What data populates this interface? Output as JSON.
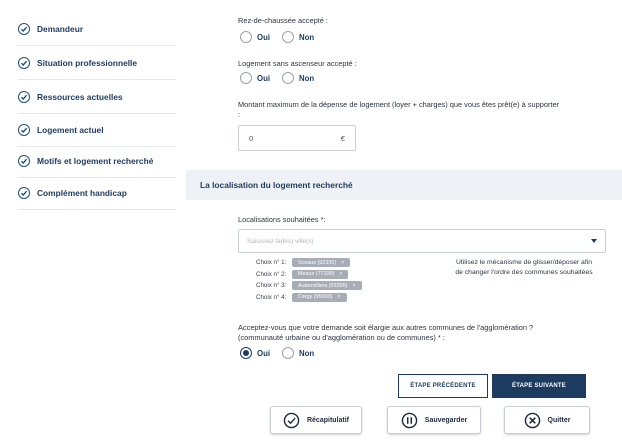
{
  "sidebar": {
    "items": [
      {
        "label": "Demandeur"
      },
      {
        "label": "Situation professionnelle"
      },
      {
        "label": "Ressources actuelles"
      },
      {
        "label": "Logement actuel"
      },
      {
        "label": "Motifs et logement recherché"
      },
      {
        "label": "Complément handicap"
      }
    ]
  },
  "form": {
    "rdc": {
      "label": "Rez-de-chaussée accepté :",
      "oui": "Oui",
      "non": "Non"
    },
    "sans_ascenseur": {
      "label": "Logement sans ascenseur accepté :",
      "oui": "Oui",
      "non": "Non"
    },
    "montant": {
      "label": "Montant maximum de la dépense de logement (loyer + charges) que vous êtes prêt(e) à supporter",
      "label_cont": ":",
      "value": "0",
      "unit": "€"
    },
    "section_title": "La localisation du logement recherché",
    "localisations": {
      "label": "Localisations souhaitées *:",
      "placeholder": "Saisissez la(les) ville(s)",
      "choices": [
        {
          "num": "Choix n° 1:",
          "city": "Sceaux (92330)",
          "remove": "×"
        },
        {
          "num": "Choix n° 2:",
          "city": "Meaux (77100)",
          "remove": "×"
        },
        {
          "num": "Choix n° 3:",
          "city": "Aubervilliers (93300)",
          "remove": "×"
        },
        {
          "num": "Choix n° 4:",
          "city": "Cergy (95000)",
          "remove": "×"
        }
      ],
      "hint": "Utilisez le mécanisme de glisser/déposer afin de changer l'ordre des communes souhaitées"
    },
    "elargie": {
      "label": "Acceptez-vous que votre demande soit élargie aux autres communes de l'agglomération ?",
      "label_line2": "(communauté urbaine ou d'agglomération ou de communes) * :",
      "oui": "Oui",
      "non": "Non",
      "selected": "Oui"
    }
  },
  "buttons": {
    "prev": "ÉTAPE PRÉCÉDENTE",
    "next": "ÉTAPE SUIVANTE",
    "recap": "Récapitulatif",
    "save": "Sauvegarder",
    "quit": "Quitter"
  },
  "colors": {
    "brand": "#1d3a5f",
    "band": "#eef1f5",
    "chip": "#a7adb6"
  }
}
